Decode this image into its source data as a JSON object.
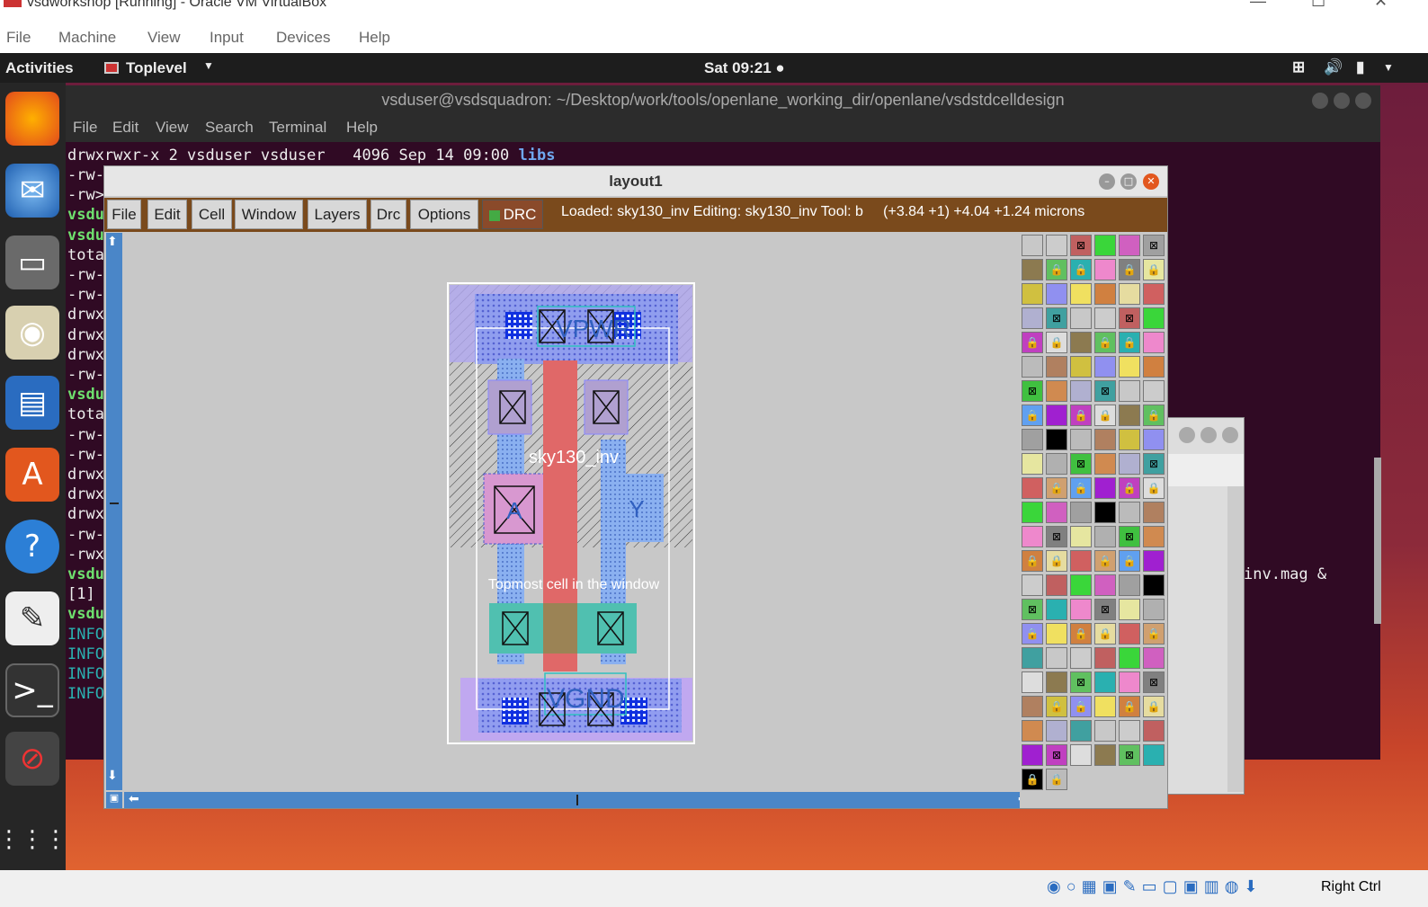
{
  "vbox": {
    "title": "vsdworkshop [Running] - Oracle VM VirtualBox",
    "menu": [
      "File",
      "Machine",
      "View",
      "Input",
      "Devices",
      "Help"
    ],
    "host_key": "Right Ctrl"
  },
  "topbar": {
    "activities": "Activities",
    "app": "Toplevel",
    "clock": "Sat 09:21 ●"
  },
  "dock": [
    "firefox-icon",
    "thunderbird-icon",
    "files-icon",
    "rhythmbox-icon",
    "writer-icon",
    "software-icon",
    "help-icon",
    "text-editor-icon",
    "terminal-icon",
    "blocked-icon",
    "apps-grid-icon"
  ],
  "terminal": {
    "title": "vsduser@vsdsquadron: ~/Desktop/work/tools/openlane_working_dir/openlane/vsdstdcelldesign",
    "menu": [
      "File",
      "Edit",
      "View",
      "Search",
      "Terminal",
      "Help"
    ],
    "first_line": "drwxrwxr-x 2 vsduser vsduser   4096 Sep 14 09:00 ",
    "first_line_dir": "libs",
    "lines": [
      "-rw-",
      "-rw>",
      "vsdu",
      "vsdu",
      "tota",
      "-rw-",
      "-rw-",
      "drwx",
      "drwx",
      "drwx",
      "-rw-",
      "vsdu",
      "tota",
      "-rw-",
      "-rw-",
      "drwx",
      "drwx",
      "drwx",
      "-rw-",
      "-rwx",
      "vsdu",
      "[1]",
      "vsdu",
      "INFO",
      "INFO",
      "INFO",
      "INFO"
    ],
    "right_text": "inv.mag &"
  },
  "magic": {
    "title": "layout1",
    "menu": [
      "File",
      "Edit",
      "Cell",
      "Window",
      "Layers",
      "Drc",
      "Options"
    ],
    "drc": "DRC",
    "status": "Loaded: sky130_inv Editing: sky130_inv Tool: b     (+3.84 +1) +4.04 +1.24 microns",
    "labels": {
      "vpwr": "VPWR",
      "vgnd": "VGND",
      "cell": "sky130_inv",
      "a": "A",
      "y": "Y",
      "topmost": "Topmost cell in the window"
    }
  }
}
